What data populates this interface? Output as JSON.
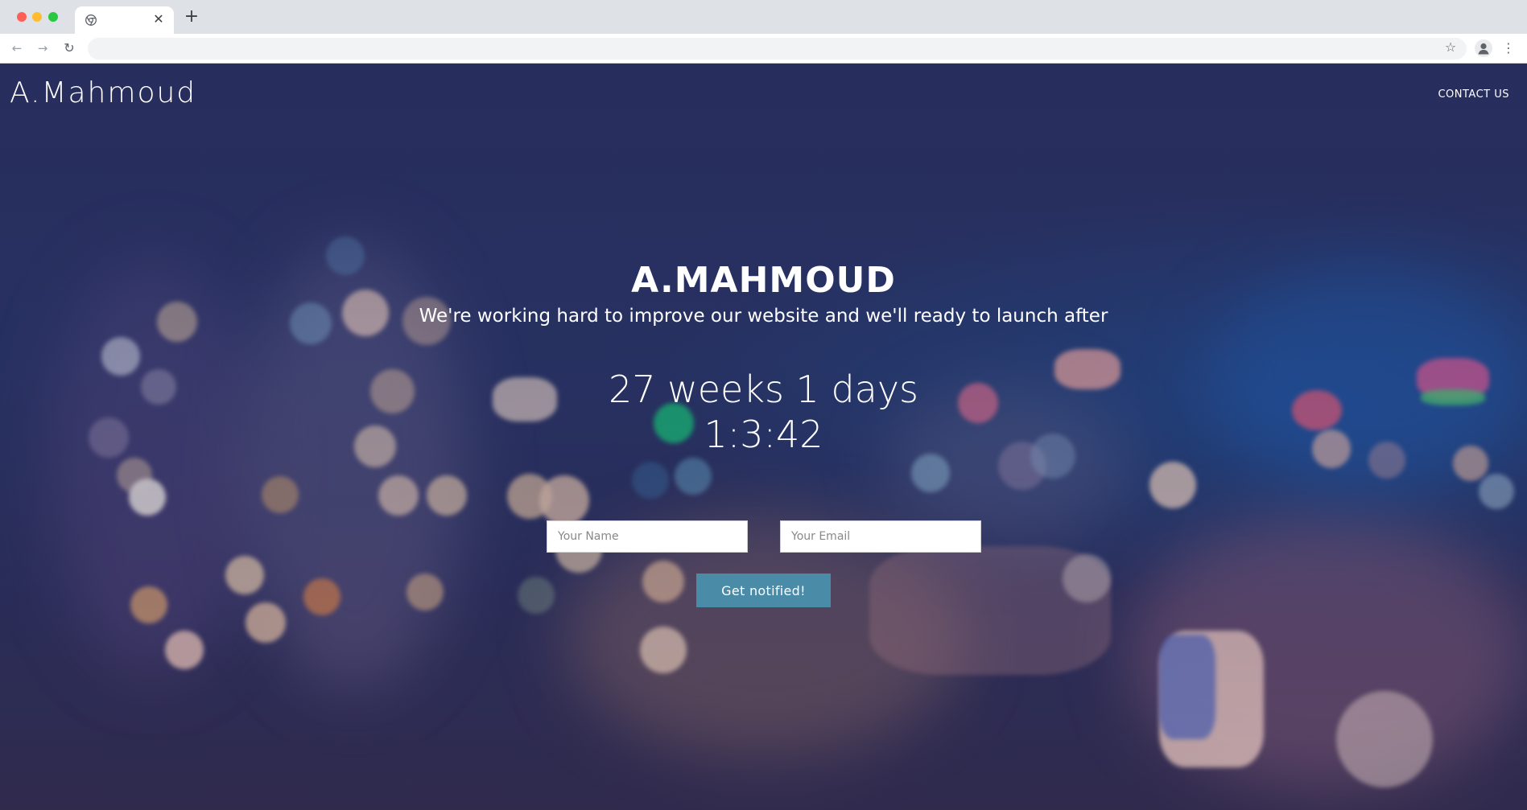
{
  "browser": {
    "tab": {
      "title": ""
    },
    "omnibox": {
      "value": ""
    }
  },
  "page": {
    "brand": "A.Mahmoud",
    "nav": {
      "contact_label": "CONTACT US"
    },
    "hero": {
      "title": "A.MAHMOUD",
      "subtitle": "We're working hard to improve our website and we'll ready to launch after"
    },
    "countdown": {
      "line1": "27 weeks 1 days",
      "line2": "1:3:42"
    },
    "form": {
      "name_placeholder": "Your Name",
      "email_placeholder": "Your Email",
      "submit_label": "Get notified!"
    }
  },
  "colors": {
    "background": "#283566",
    "button": "#4a8ca8",
    "text": "#ffffff"
  }
}
